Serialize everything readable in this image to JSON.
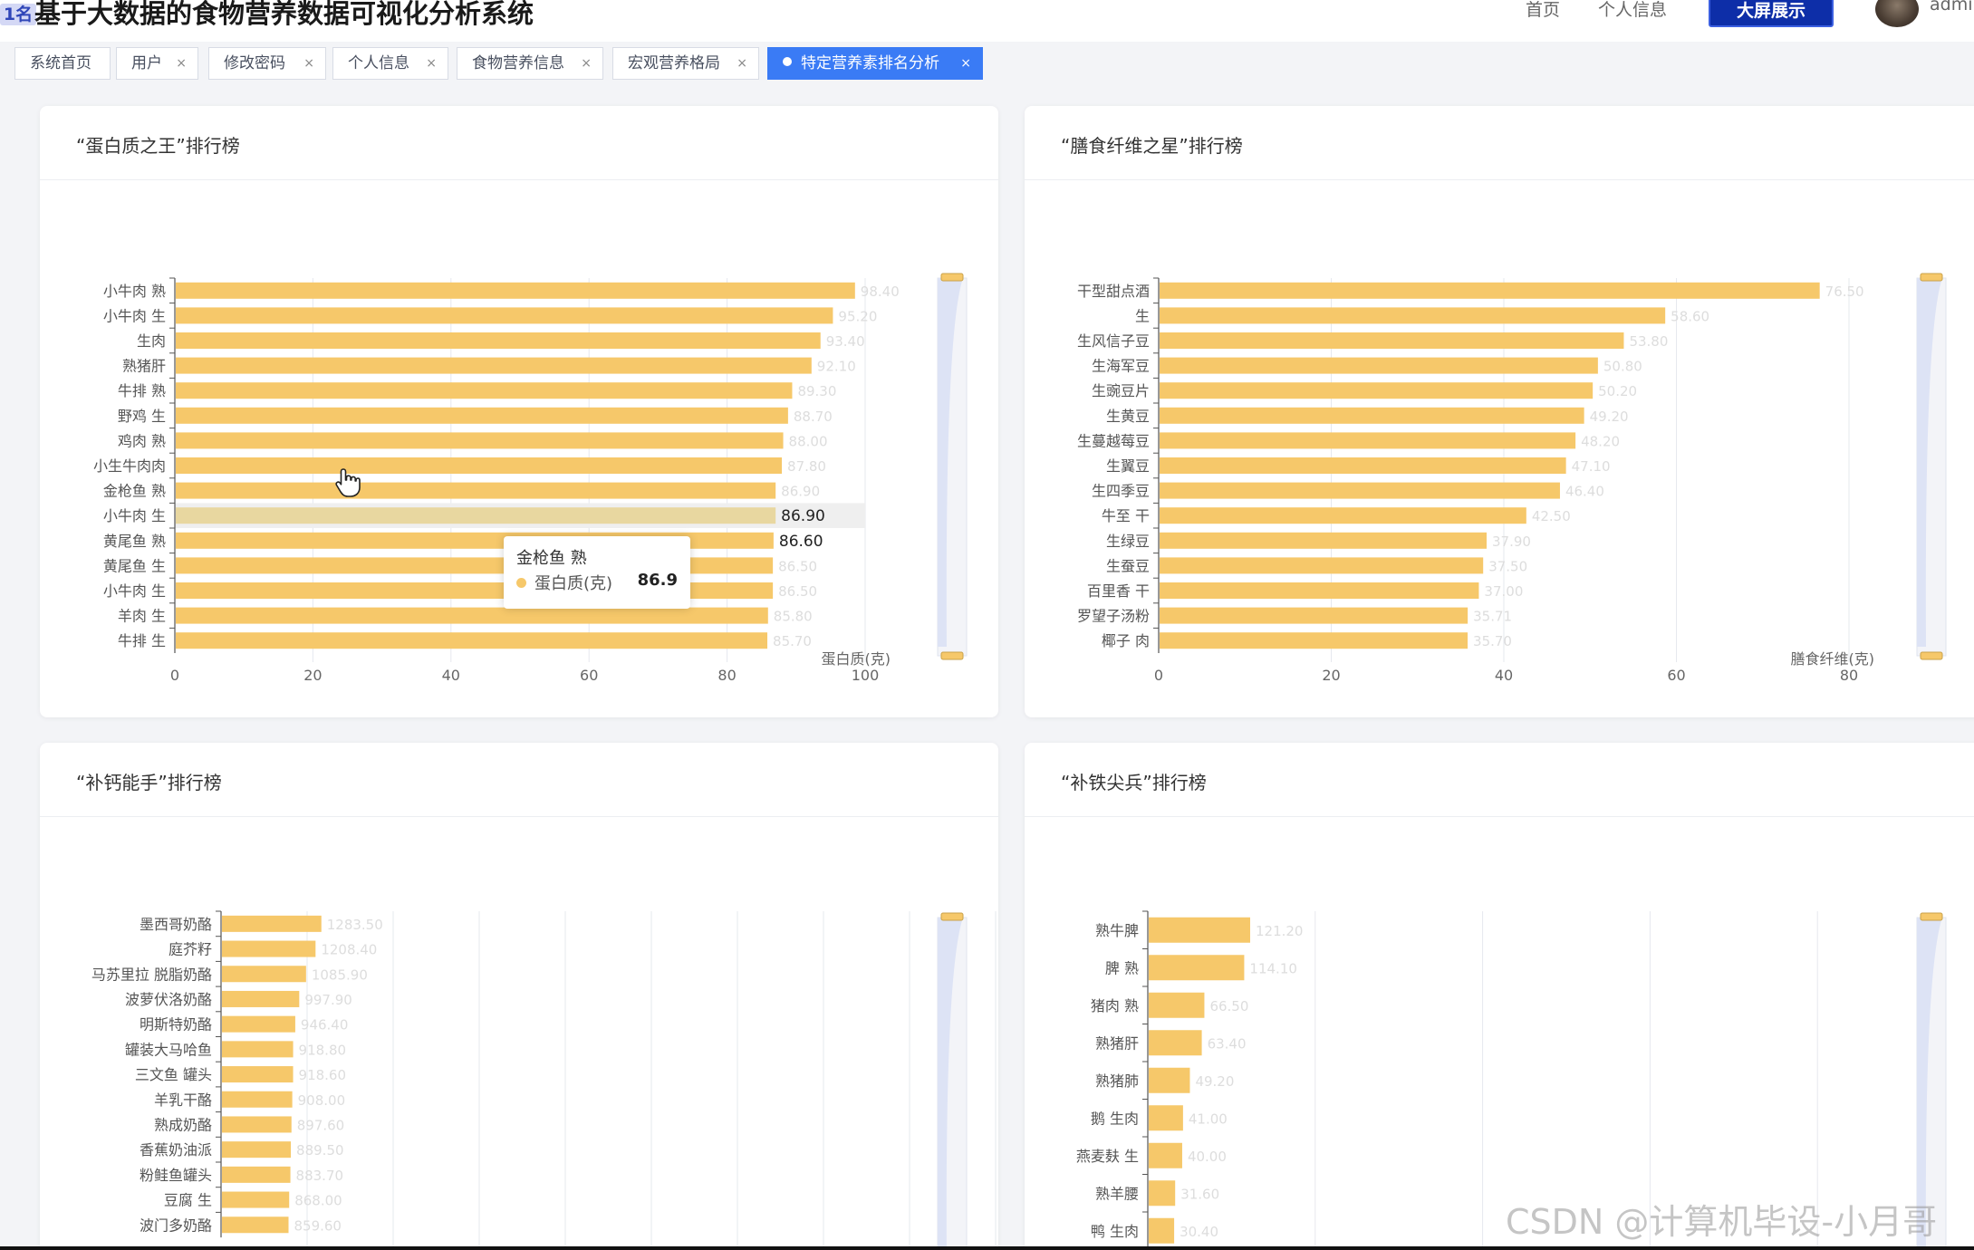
{
  "app": {
    "badge": "1名",
    "title": "基于大数据的食物营养数据可视化分析系统"
  },
  "header": {
    "home": "首页",
    "profile": "个人信息",
    "big_screen": "大屏展示",
    "user": "admin"
  },
  "tabs": [
    {
      "label": "系统首页",
      "closable": false,
      "active": false
    },
    {
      "label": "用户",
      "closable": true,
      "active": false
    },
    {
      "label": "修改密码",
      "closable": true,
      "active": false
    },
    {
      "label": "个人信息",
      "closable": true,
      "active": false
    },
    {
      "label": "食物营养信息",
      "closable": true,
      "active": false
    },
    {
      "label": "宏观营养格局",
      "closable": true,
      "active": false
    },
    {
      "label": "特定营养素排名分析",
      "closable": true,
      "active": true
    }
  ],
  "tab_close_glyph": "×",
  "colors": {
    "bar": "#f6c86a",
    "bar_highlight": "#e8d7a0",
    "accent": "#3a7bf5",
    "big_screen_button": "#0d2ea8"
  },
  "chart_data": [
    {
      "type": "bar",
      "orientation": "horizontal",
      "title": "“蛋白质之王”排行榜",
      "categories": [
        "小牛肉 熟",
        "小牛肉 生",
        "生肉",
        "熟猪肝",
        "牛排 熟",
        "野鸡 生",
        "鸡肉 熟",
        "小生牛肉肉",
        "金枪鱼 熟",
        "小牛肉 生",
        "黄尾鱼 熟",
        "黄尾鱼 生",
        "小牛肉 生",
        "羊肉 生",
        "牛排 生"
      ],
      "values": [
        98.4,
        95.2,
        93.4,
        92.1,
        89.3,
        88.7,
        88.0,
        87.8,
        86.9,
        86.9,
        86.6,
        86.5,
        86.5,
        85.8,
        85.7
      ],
      "value_labels": [
        "98.40",
        "95.20",
        "93.40",
        "92.10",
        "89.30",
        "88.70",
        "88.00",
        "87.80",
        "86.90",
        "86.90",
        "86.60",
        "86.50",
        "86.50",
        "85.80",
        "85.70"
      ],
      "axis_name": "蛋白质(克)",
      "xticks": [
        "0",
        "20",
        "40",
        "60",
        "80",
        "100"
      ],
      "xlim": [
        0,
        100
      ],
      "highlight_index": 9,
      "emphasis_index": 10
    },
    {
      "type": "bar",
      "orientation": "horizontal",
      "title": "“膳食纤维之星”排行榜",
      "categories": [
        "干型甜点酒",
        "生",
        "生风信子豆",
        "生海军豆",
        "生豌豆片",
        "生黄豆",
        "生蔓越莓豆",
        "生翼豆",
        "生四季豆",
        "牛至 干",
        "生绿豆",
        "生蚕豆",
        "百里香 干",
        "罗望子汤粉",
        "椰子 肉"
      ],
      "values": [
        76.5,
        58.6,
        53.8,
        50.8,
        50.2,
        49.2,
        48.2,
        47.1,
        46.4,
        42.5,
        37.9,
        37.5,
        37.0,
        35.71,
        35.7
      ],
      "value_labels": [
        "76.50",
        "58.60",
        "53.80",
        "50.80",
        "50.20",
        "49.20",
        "48.20",
        "47.10",
        "46.40",
        "42.50",
        "37.90",
        "37.50",
        "37.00",
        "35.71",
        "35.70"
      ],
      "axis_name": "膳食纤维(克)",
      "xticks": [
        "0",
        "20",
        "40",
        "60",
        "80"
      ],
      "xlim": [
        0,
        80
      ]
    },
    {
      "type": "bar",
      "orientation": "horizontal",
      "title": "“补钙能手”排行榜",
      "categories": [
        "墨西哥奶酪",
        "庭芥籽",
        "马苏里拉 脱脂奶酪",
        "波萝伏洛奶酪",
        "明斯特奶酪",
        "罐装大马哈鱼",
        "三文鱼 罐头",
        "羊乳干酪",
        "熟成奶酪",
        "香蕉奶油派",
        "粉鲑鱼罐头",
        "豆腐 生",
        "波门多奶酪"
      ],
      "values": [
        1283.5,
        1208.4,
        1085.9,
        997.9,
        946.4,
        918.8,
        918.6,
        908.0,
        897.6,
        889.5,
        883.7,
        868.0,
        859.6
      ],
      "value_labels": [
        "1283.50",
        "1208.40",
        "1085.90",
        "997.90",
        "946.40",
        "918.80",
        "918.60",
        "908.00",
        "897.60",
        "889.50",
        "883.70",
        "868.00",
        "859.60"
      ],
      "xlim": [
        0,
        10000
      ]
    },
    {
      "type": "bar",
      "orientation": "horizontal",
      "title": "“补铁尖兵”排行榜",
      "categories": [
        "熟牛脾",
        "脾 熟",
        "猪肉 熟",
        "熟猪肝",
        "熟猪肺",
        "鹅 生肉",
        "燕麦麸 生",
        "熟羊腰",
        "鸭 生肉"
      ],
      "values": [
        121.2,
        114.1,
        66.5,
        63.4,
        49.2,
        41.0,
        40.0,
        31.6,
        30.4
      ],
      "value_labels": [
        "121.20",
        "114.10",
        "66.50",
        "63.40",
        "49.20",
        "41.00",
        "40.00",
        "31.60",
        "30.40"
      ],
      "xlim": [
        0,
        1000
      ]
    }
  ],
  "tooltip": {
    "title": "金枪鱼 熟",
    "series": "蛋白质(克)",
    "value": "86.9"
  },
  "watermark": "CSDN @计算机毕设-小月哥"
}
